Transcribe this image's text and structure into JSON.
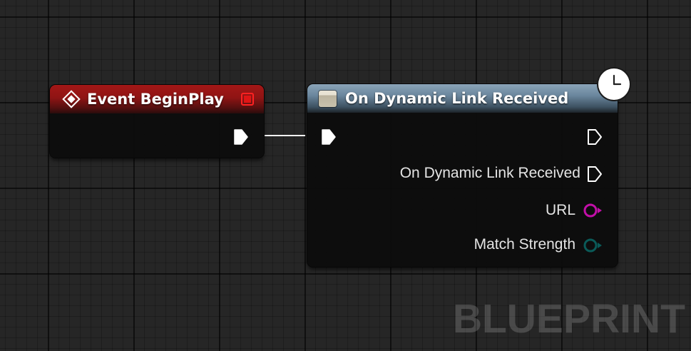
{
  "graph": {
    "event_node": {
      "title": "Event BeginPlay",
      "icon": "event-diamond-icon",
      "header_color": "#8f1414",
      "delegate_pin_color": "#e01515"
    },
    "dynamic_link_node": {
      "title": "On Dynamic Link Received",
      "icon": "function-icon",
      "header_color": "#6a869d",
      "latent_icon": "clock-icon",
      "pins": {
        "exec_out_label": "",
        "delegate_exec_label": "On Dynamic Link Received",
        "url_label": "URL",
        "url_color": "#c20fa8",
        "match_strength_label": "Match Strength",
        "match_strength_color": "#0a5a58"
      }
    },
    "wire_color": "#ffffff"
  },
  "watermark": "BLUEPRINT"
}
